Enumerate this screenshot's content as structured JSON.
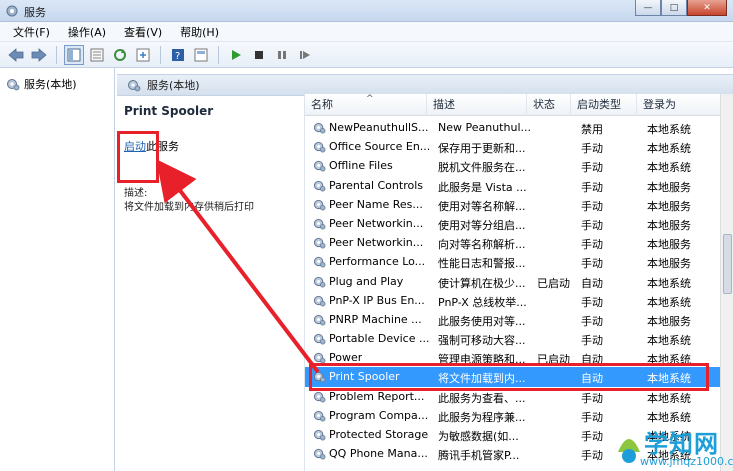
{
  "window": {
    "title": "服务"
  },
  "menu": [
    "文件(F)",
    "操作(A)",
    "查看(V)",
    "帮助(H)"
  ],
  "nav": {
    "root_label": "服务(本地)"
  },
  "pane_header": {
    "label": "服务(本地)"
  },
  "desc": {
    "service_name": "Print Spooler",
    "start_link": "启动",
    "start_suffix": "此服务",
    "desc_label": "描述:",
    "desc_text": "将文件加载到内存供稍后打印"
  },
  "columns": [
    "名称",
    "描述",
    "状态",
    "启动类型",
    "登录为"
  ],
  "services": [
    {
      "name": "NewPeanuthullS...",
      "desc": "New Peanuthul...",
      "status": "",
      "start": "禁用",
      "logon": "本地系统"
    },
    {
      "name": "Office Source En...",
      "desc": "保存用于更新和...",
      "status": "",
      "start": "手动",
      "logon": "本地系统"
    },
    {
      "name": "Offline Files",
      "desc": "脱机文件服务在...",
      "status": "",
      "start": "手动",
      "logon": "本地系统"
    },
    {
      "name": "Parental Controls",
      "desc": "此服务是 Vista ...",
      "status": "",
      "start": "手动",
      "logon": "本地服务"
    },
    {
      "name": "Peer Name Res...",
      "desc": "使用对等名称解...",
      "status": "",
      "start": "手动",
      "logon": "本地服务"
    },
    {
      "name": "Peer Networkin...",
      "desc": "使用对等分组启...",
      "status": "",
      "start": "手动",
      "logon": "本地服务"
    },
    {
      "name": "Peer Networkin...",
      "desc": "向对等名称解析...",
      "status": "",
      "start": "手动",
      "logon": "本地服务"
    },
    {
      "name": "Performance Lo...",
      "desc": "性能日志和警报...",
      "status": "",
      "start": "手动",
      "logon": "本地服务"
    },
    {
      "name": "Plug and Play",
      "desc": "使计算机在极少...",
      "status": "已启动",
      "start": "自动",
      "logon": "本地系统"
    },
    {
      "name": "PnP-X IP Bus En...",
      "desc": "PnP-X 总线枚举...",
      "status": "",
      "start": "手动",
      "logon": "本地系统"
    },
    {
      "name": "PNRP Machine ...",
      "desc": "此服务使用对等...",
      "status": "",
      "start": "手动",
      "logon": "本地服务"
    },
    {
      "name": "Portable Device ...",
      "desc": "强制可移动大容...",
      "status": "",
      "start": "手动",
      "logon": "本地系统"
    },
    {
      "name": "Power",
      "desc": "管理电源策略和...",
      "status": "已启动",
      "start": "自动",
      "logon": "本地系统"
    },
    {
      "name": "Print Spooler",
      "desc": "将文件加载到内...",
      "status": "",
      "start": "自动",
      "logon": "本地系统"
    },
    {
      "name": "Problem Report...",
      "desc": "此服务为查看、...",
      "status": "",
      "start": "手动",
      "logon": "本地系统"
    },
    {
      "name": "Program Compa...",
      "desc": "此服务为程序兼...",
      "status": "",
      "start": "手动",
      "logon": "本地系统"
    },
    {
      "name": "Protected Storage",
      "desc": "为敏感数据(如...",
      "status": "",
      "start": "手动",
      "logon": "本地系统"
    },
    {
      "name": "QQ Phone Mana...",
      "desc": "腾讯手机管家P...",
      "status": "",
      "start": "手动",
      "logon": "本地系统"
    }
  ],
  "selected_index": 13,
  "watermark": {
    "text": "学知网",
    "url": "www.jmqz1000.com"
  },
  "colors": {
    "accent": "#3399ff",
    "annotation": "#e8202a",
    "link": "#1f62b3"
  }
}
